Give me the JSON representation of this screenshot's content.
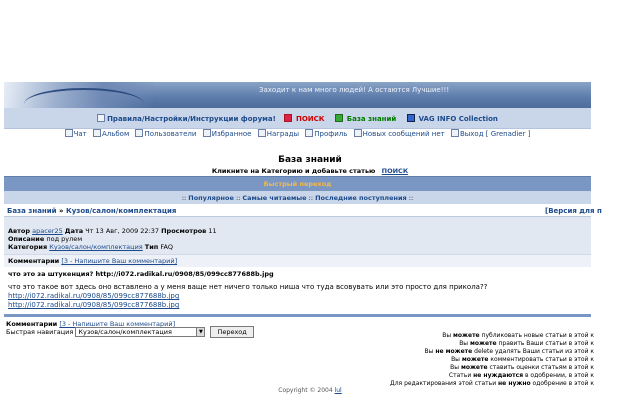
{
  "banner": {
    "tagline": "Заходит к нам много людей! А остаются Лучшие!!!"
  },
  "nav_main": {
    "rules": "Правила/Настройки/Инструкции форума!",
    "search": "ПОИСК",
    "knowledge": "База знаний",
    "vag": "VAG INFO Collection"
  },
  "nav_user": {
    "chat": "Чат",
    "album": "Альбом",
    "users": "Пользователи",
    "favorites": "Избранное",
    "awards": "Награды",
    "profile": "Профиль",
    "no_new": "Новых сообщений нет",
    "logout": "Выход [ Grenadier ]"
  },
  "kb": {
    "title": "База знаний",
    "subtitle": "Кликните на Категорию и добавьте статью",
    "search_link": "ПОИСК"
  },
  "quick_nav": "Быстрый переход",
  "tabs": {
    "popular": "Популярное",
    "most_read": "Самые читаемые",
    "latest": "Последние поступления"
  },
  "breadcrumb": {
    "root": "База знаний",
    "sep": "»",
    "category": "Кузов/салон/комплектация",
    "version": "[Версия для п"
  },
  "article": {
    "author_label": "Автор",
    "author": "apacer25",
    "date_label": "Дата",
    "date": "Чт 13 Авг, 2009 22:37",
    "views_label": "Просмотров",
    "views": "11",
    "desc_label": "Описание",
    "desc": "под рулем",
    "category_label": "Категория",
    "category": "Кузов/салон/комплектация",
    "type_label": "Тип",
    "type": "FAQ"
  },
  "comments": {
    "label": "Комментарии",
    "link": "[3 - Напишите Ваш комментарий]"
  },
  "post": {
    "question": "что это за штукенция? http://i072.radikal.ru/0908/85/099cc877688b.jpg",
    "body": "что это такое вот здесь оно вставлено а у меня ваще нет ничего только ниша что туда всовувать или это просто для прикола??",
    "link1": "http://i072.radikal.ru/0908/85/099cc877688b.jpg",
    "link2": "http://i072.radikal.ru/0908/85/099cc877688b.jpg"
  },
  "quick_jump": {
    "label": "Быстрая навигация",
    "selected": "Кузов/салон/комплектация",
    "button": "Переход"
  },
  "permissions": [
    {
      "pre": "Вы ",
      "bold": "можете",
      "post": " публиковать новые статьи в этой к"
    },
    {
      "pre": "Вы ",
      "bold": "можете",
      "post": " править Ваши статьи в этой к"
    },
    {
      "pre": "Вы ",
      "bold": "не можете",
      "post": " delete удалять Ваши статьи из этой к"
    },
    {
      "pre": "Вы ",
      "bold": "можете",
      "post": " комментировать статьи в этой к"
    },
    {
      "pre": "Вы ",
      "bold": "можете",
      "post": " ставить оценки статьям в этой к"
    },
    {
      "pre": "Статьи ",
      "bold": "не нуждаются",
      "post": " в одобрении, в этой к"
    },
    {
      "pre": "Для редактирования этой статьи ",
      "bold": "не нужно",
      "post": " одобрение в этой к"
    }
  ],
  "footer": {
    "copyright": "Copyright © 2004 ",
    "author_link": "lul"
  }
}
